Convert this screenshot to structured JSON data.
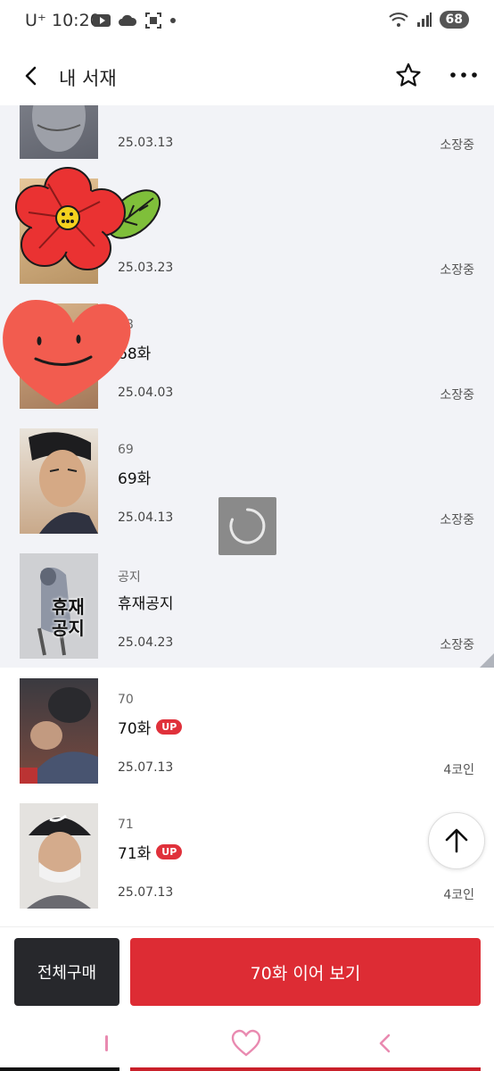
{
  "status_bar": {
    "carrier": "U⁺",
    "time": "10:20",
    "battery": "68",
    "left_icons": [
      "youtube-icon",
      "cloud-icon",
      "screenshot-icon",
      "dot-icon"
    ],
    "right_icons": [
      "wifi-icon",
      "signal-icon"
    ]
  },
  "header": {
    "title": "내 서재",
    "back_icon": "chevron-left-icon",
    "star_icon": "star-outline-icon",
    "more_icon": "more-horizontal-icon"
  },
  "episodes": [
    {
      "number": "",
      "title": "",
      "date": "25.03.13",
      "status": "소장중",
      "up": false,
      "owned": true
    },
    {
      "number": "",
      "title": "",
      "date": "25.03.23",
      "status": "소장중",
      "up": false,
      "owned": true
    },
    {
      "number": "68",
      "title": "68화",
      "date": "25.04.03",
      "status": "소장중",
      "up": false,
      "owned": true
    },
    {
      "number": "69",
      "title": "69화",
      "date": "25.04.13",
      "status": "소장중",
      "up": false,
      "owned": true
    },
    {
      "number": "공지",
      "title": "휴재공지",
      "date": "25.04.23",
      "status": "소장중",
      "up": false,
      "owned": true,
      "thumb_text": "휴재\n공지"
    },
    {
      "number": "70",
      "title": "70화",
      "date": "25.07.13",
      "status": "4코인",
      "up": true,
      "owned": false
    },
    {
      "number": "71",
      "title": "71화",
      "date": "25.07.13",
      "status": "4코인",
      "up": true,
      "owned": false
    }
  ],
  "up_badge": "UP",
  "actions": {
    "buy_all": "전체구매",
    "continue": "70화 이어 보기"
  },
  "colors": {
    "accent": "#dd2c34",
    "dark_button": "#27282c",
    "owned_bg": "#f2f3f7"
  }
}
